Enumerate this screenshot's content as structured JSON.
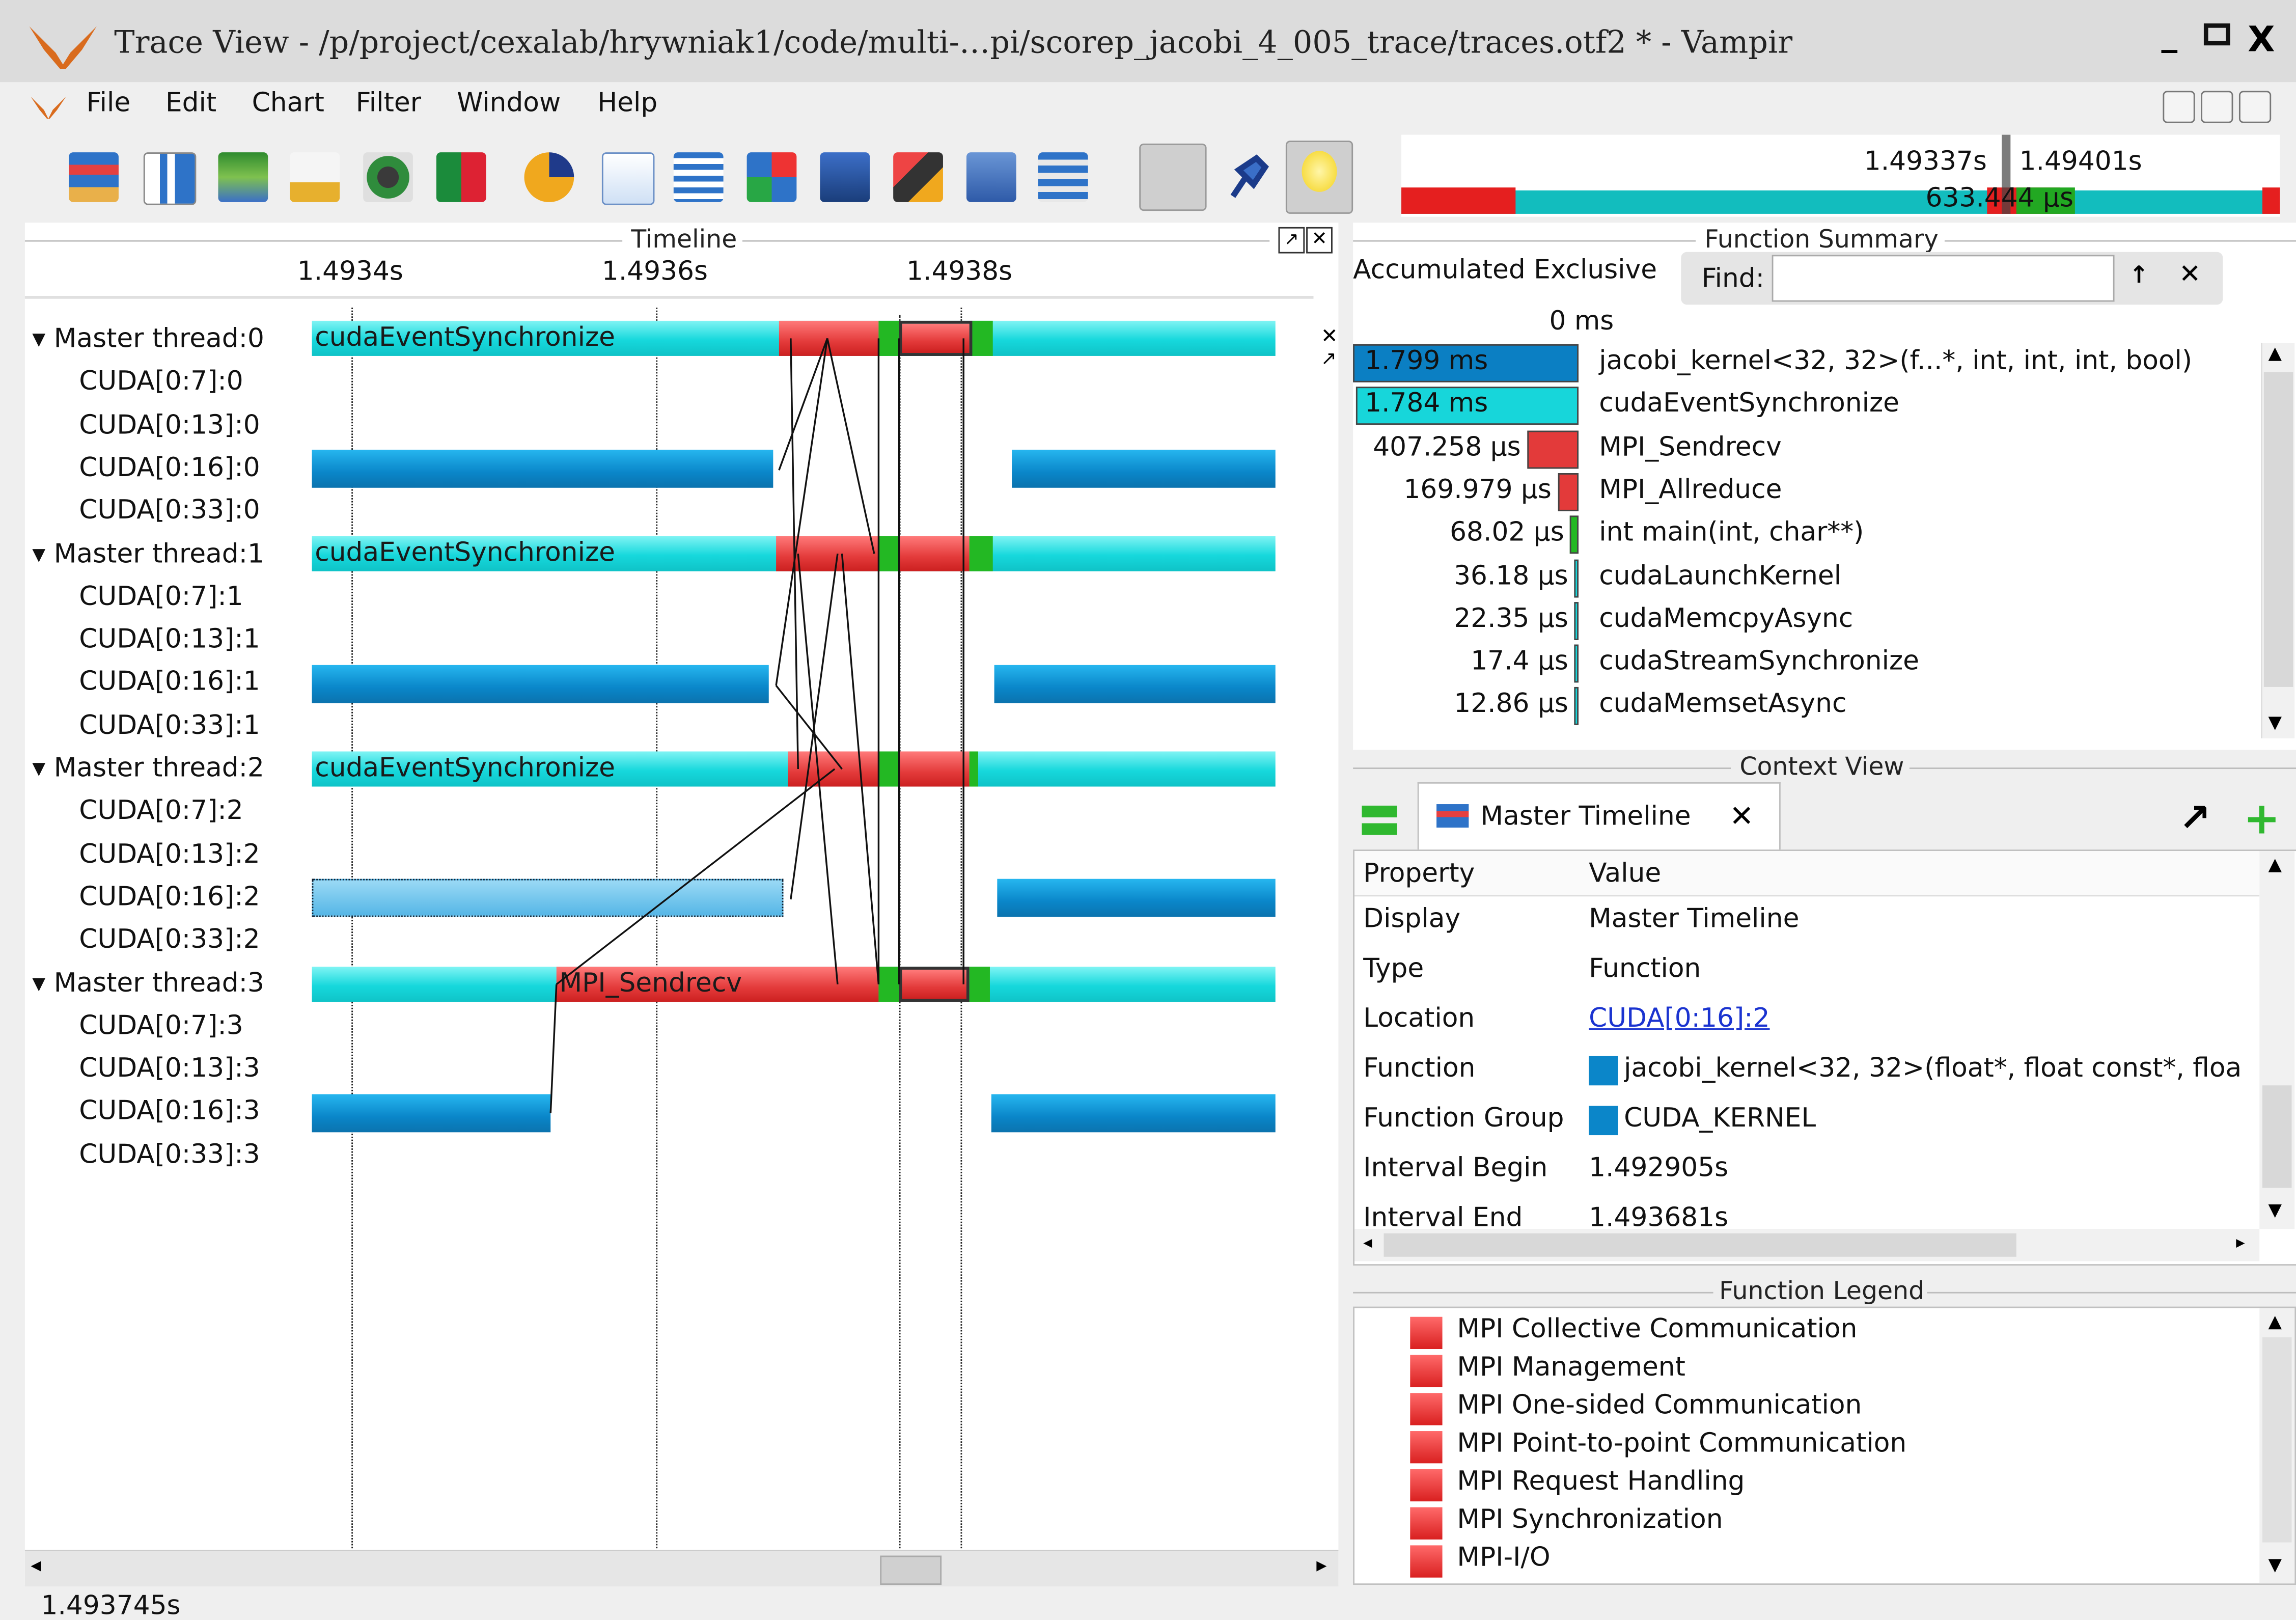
{
  "window": {
    "title": "Trace View - /p/project/cexalab/hrywniak1/code/multi-…pi/scorep_jacobi_4_005_trace/traces.otf2 * - Vampir",
    "minimize": "_",
    "maximize": "□",
    "close": "X"
  },
  "menu": [
    "File",
    "Edit",
    "Chart",
    "Filter",
    "Window",
    "Help"
  ],
  "toolbar": {
    "icons": [
      "master-timeline",
      "process-timeline",
      "counter-data-timeline",
      "performance-radar",
      "io-timeline",
      "call-tree",
      "function-summary-pie",
      "message-summary",
      "process-summary",
      "communication-matrix",
      "call-graph",
      "io-summary",
      "counter-summary",
      "master-legend",
      "context-view",
      "pin-tool",
      "hint-bulb"
    ],
    "zoom": {
      "start": "1.49337s",
      "end": "1.49401s",
      "duration": "633.444 µs"
    }
  },
  "timeline": {
    "title": "Timeline",
    "ticks": [
      "1.4934s",
      "1.4936s",
      "1.4938s"
    ],
    "rows": [
      "Master thread:0",
      "CUDA[0:7]:0",
      "CUDA[0:13]:0",
      "CUDA[0:16]:0",
      "CUDA[0:33]:0",
      "Master thread:1",
      "CUDA[0:7]:1",
      "CUDA[0:13]:1",
      "CUDA[0:16]:1",
      "CUDA[0:33]:1",
      "Master thread:2",
      "CUDA[0:7]:2",
      "CUDA[0:13]:2",
      "CUDA[0:16]:2",
      "CUDA[0:33]:2",
      "Master thread:3",
      "CUDA[0:7]:3",
      "CUDA[0:13]:3",
      "CUDA[0:16]:3",
      "CUDA[0:33]:3"
    ],
    "bar_labels": {
      "m0": "cudaEventSynchronize",
      "m1": "cudaEventSynchronize",
      "m2": "cudaEventSynchronize",
      "m3": "MPI_Sendrecv"
    },
    "cursor_time": "1.493745s"
  },
  "function_summary": {
    "title": "Function Summary",
    "mode": "Accumulated Exclusive",
    "find_label": "Find:",
    "find_value": "",
    "axis": "0 ms",
    "items": [
      {
        "value": "1.799 ms",
        "name": "jacobi_kernel<32, 32>(f...*, int, int, int, bool)",
        "color": "#0b7fc3",
        "fraction": 1.0
      },
      {
        "value": "1.784 ms",
        "name": "cudaEventSynchronize",
        "color": "#17d6da",
        "fraction": 0.99
      },
      {
        "value": "407.258 µs",
        "name": "MPI_Sendrecv",
        "color": "#e33a3a",
        "fraction": 0.23
      },
      {
        "value": "169.979 µs",
        "name": "MPI_Allreduce",
        "color": "#e33a3a",
        "fraction": 0.094
      },
      {
        "value": "68.02 µs",
        "name": "int main(int, char**)",
        "color": "#23b823",
        "fraction": 0.038
      },
      {
        "value": "36.18 µs",
        "name": "cudaLaunchKernel",
        "color": "#17d6da",
        "fraction": 0.02
      },
      {
        "value": "22.35 µs",
        "name": "cudaMemcpyAsync",
        "color": "#17d6da",
        "fraction": 0.012
      },
      {
        "value": "17.4 µs",
        "name": "cudaStreamSynchronize",
        "color": "#17d6da",
        "fraction": 0.01
      },
      {
        "value": "12.86 µs",
        "name": "cudaMemsetAsync",
        "color": "#17d6da",
        "fraction": 0.007
      }
    ]
  },
  "context_view": {
    "title": "Context View",
    "tab": "Master Timeline",
    "col_property": "Property",
    "col_value": "Value",
    "rows": [
      {
        "property": "Display",
        "value": "Master Timeline"
      },
      {
        "property": "Type",
        "value": "Function"
      },
      {
        "property": "Location",
        "value": "CUDA[0:16]:2"
      },
      {
        "property": "Function",
        "value": "jacobi_kernel<32, 32>(float*, float const*, floa"
      },
      {
        "property": "Function Group",
        "value": "CUDA_KERNEL"
      },
      {
        "property": "Interval Begin",
        "value": "1.492905s"
      },
      {
        "property": "Interval End",
        "value": "1.493681s"
      }
    ]
  },
  "function_legend": {
    "title": "Function Legend",
    "items": [
      "MPI Collective Communication",
      "MPI Management",
      "MPI One-sided Communication",
      "MPI Point-to-point Communication",
      "MPI Request Handling",
      "MPI Synchronization",
      "MPI-I/O"
    ]
  }
}
